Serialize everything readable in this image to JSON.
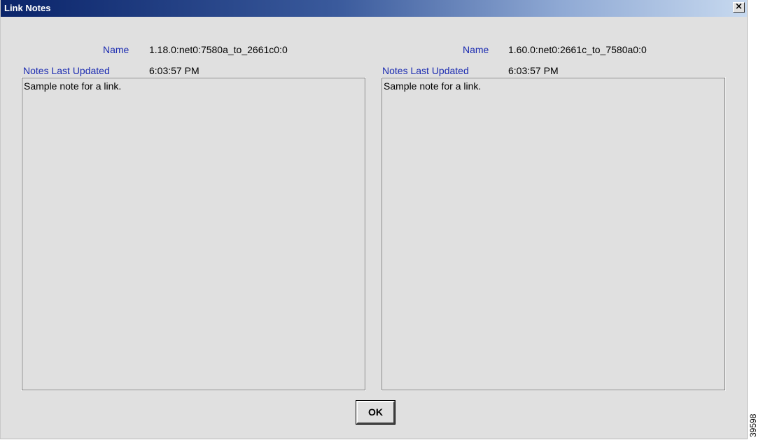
{
  "window": {
    "title": "Link Notes",
    "close_glyph": "×",
    "close_icon": "close-icon"
  },
  "left_panel": {
    "name_label": "Name",
    "name_value": "1.18.0:net0:7580a_to_2661c0:0",
    "updated_label": "Notes Last Updated",
    "updated_value": "6:03:57 PM",
    "notes_text": "Sample note for a link."
  },
  "right_panel": {
    "name_label": "Name",
    "name_value": "1.60.0:net0:2661c_to_7580a0:0",
    "updated_label": "Notes Last Updated",
    "updated_value": "6:03:57 PM",
    "notes_text": "Sample note for a link."
  },
  "buttons": {
    "ok_label": "OK"
  },
  "figure_id": "39598",
  "colors": {
    "label_blue": "#1a2ab0",
    "title_bar_start": "#0a246a",
    "title_bar_end": "#c7d9ef",
    "window_bg": "#e0e0e0"
  }
}
